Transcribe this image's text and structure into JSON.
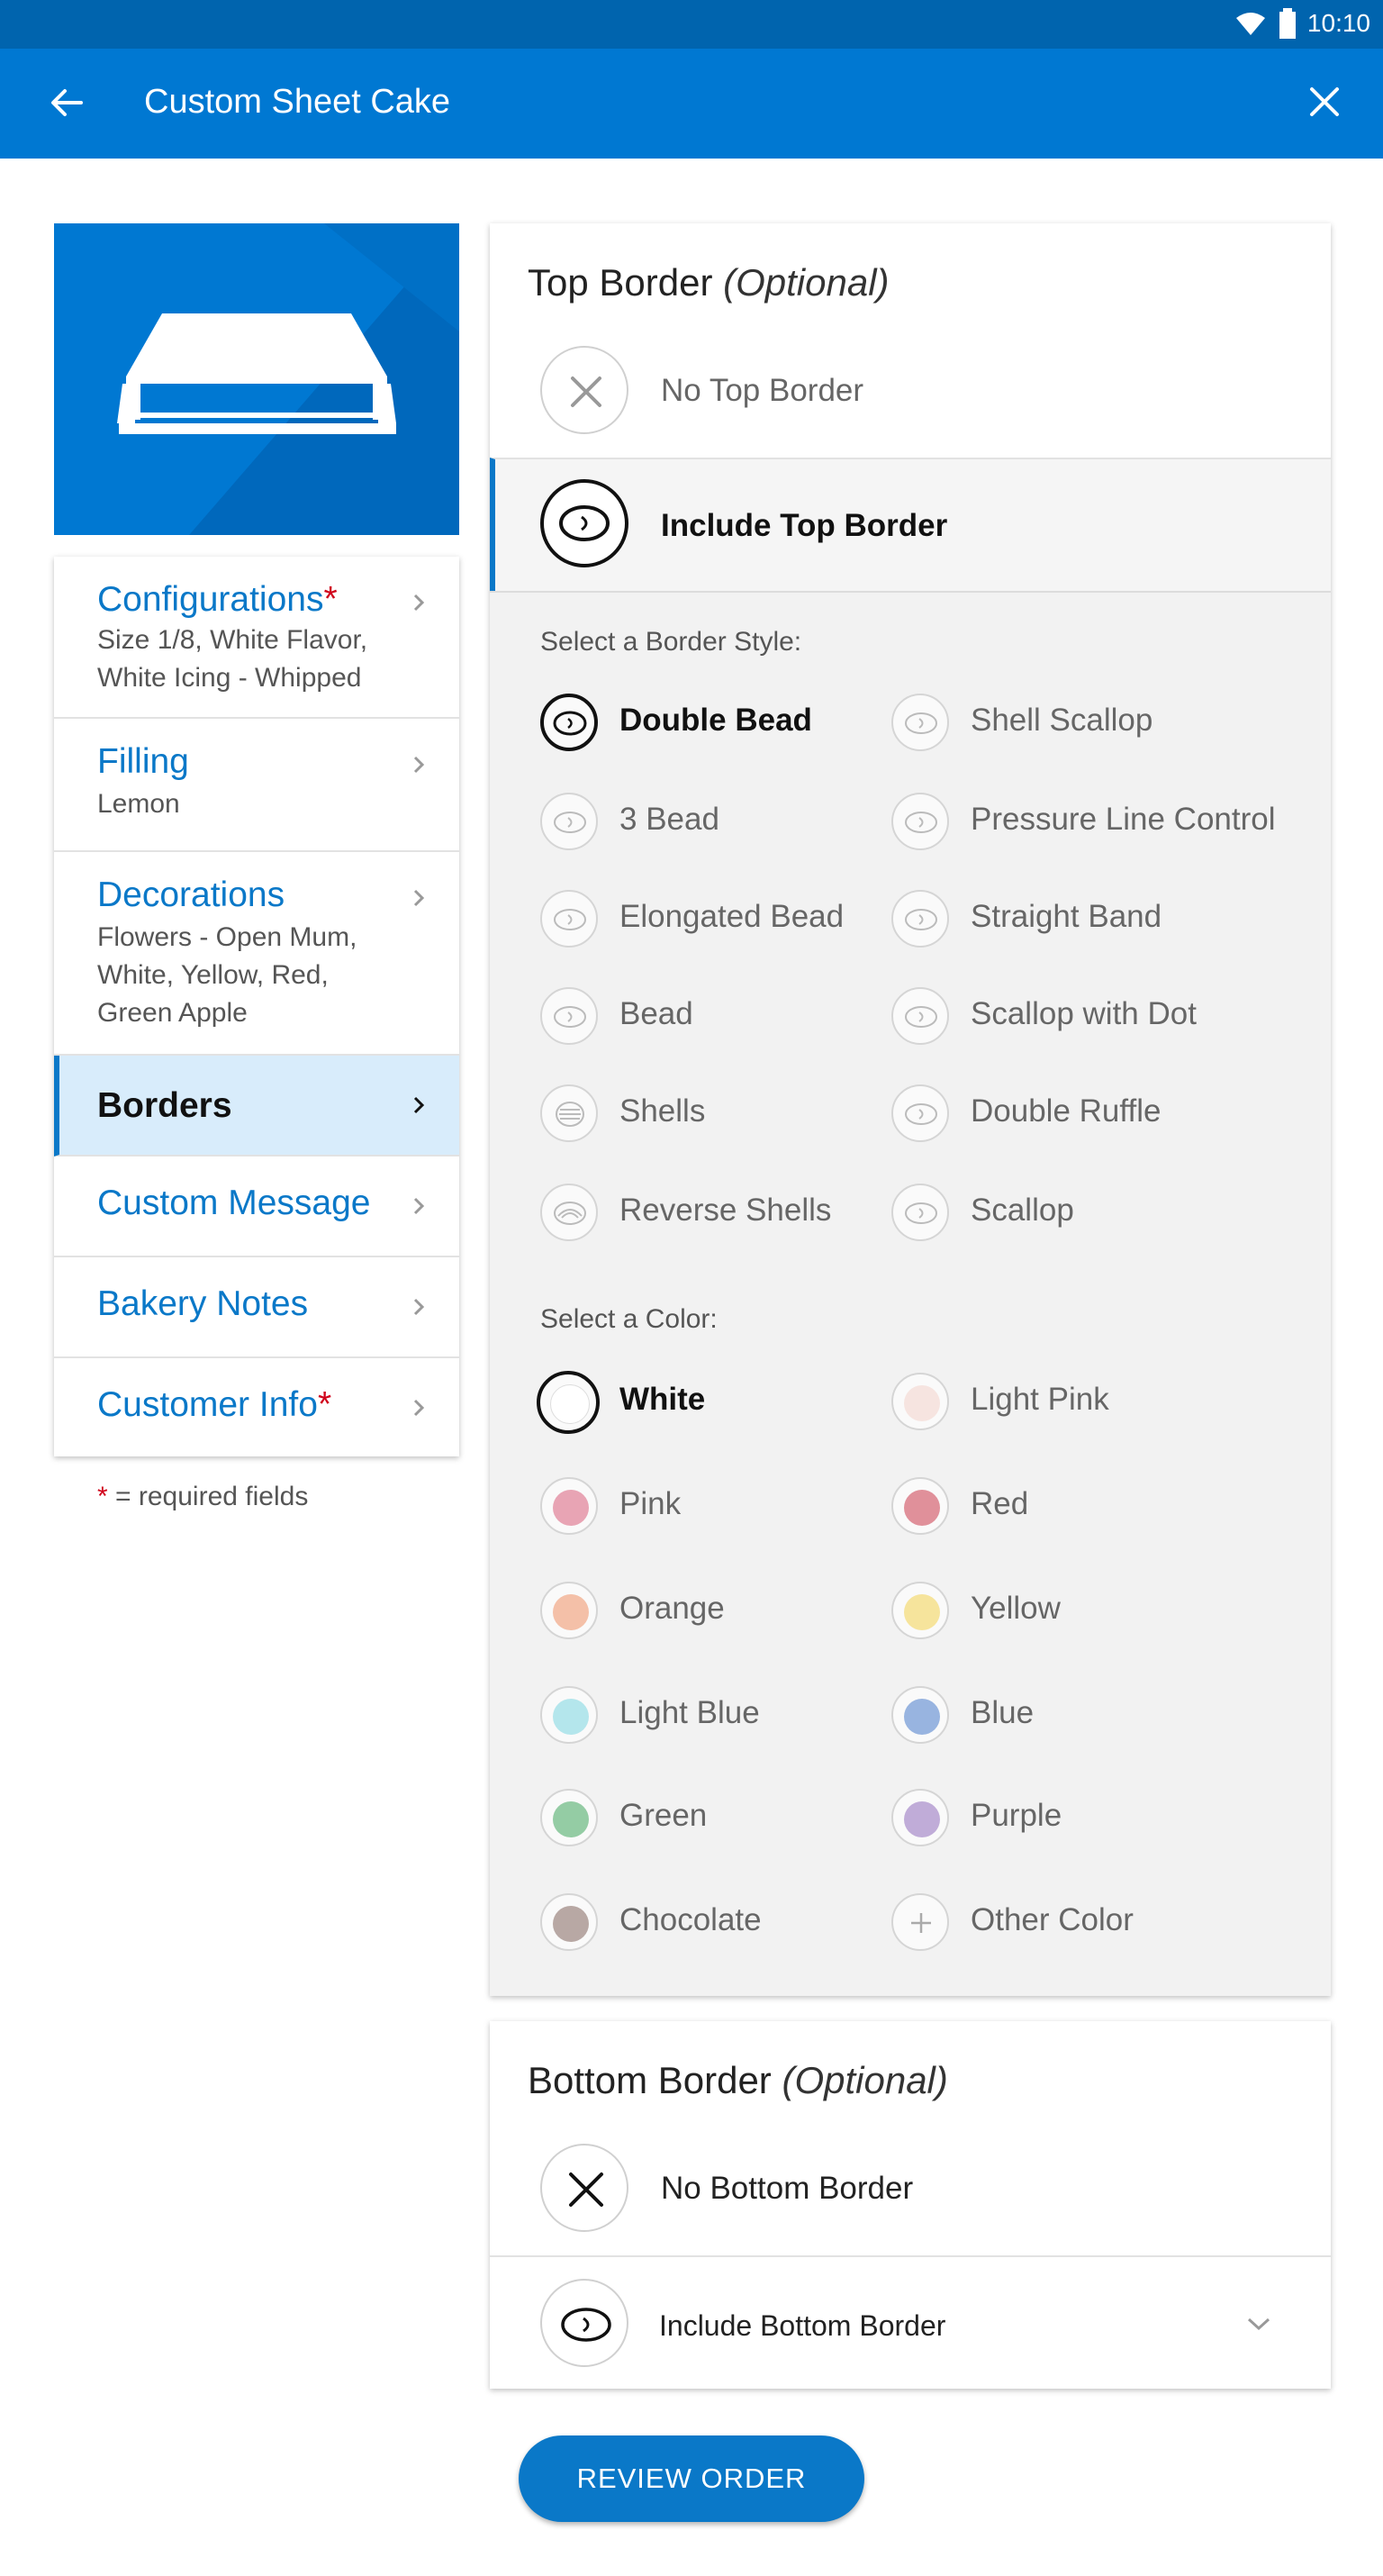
{
  "status_bar": {
    "time": "10:10"
  },
  "app_bar": {
    "title": "Custom Sheet Cake"
  },
  "nav": {
    "items": [
      {
        "label": "Configurations",
        "required": "*",
        "sub": [
          "Size 1/8, White Flavor,",
          "White Icing - Whipped"
        ]
      },
      {
        "label": "Filling",
        "required": "",
        "sub": [
          "Lemon"
        ]
      },
      {
        "label": "Decorations",
        "required": "",
        "sub": [
          "Flowers - Open Mum,",
          "White, Yellow, Red,",
          "Green Apple"
        ]
      },
      {
        "label": "Borders",
        "required": "",
        "sub": []
      },
      {
        "label": "Custom Message",
        "required": "",
        "sub": []
      },
      {
        "label": "Bakery Notes",
        "required": "",
        "sub": []
      },
      {
        "label": "Customer Info",
        "required": "*",
        "sub": []
      }
    ],
    "required_note_star": "*",
    "required_note": "= required fields"
  },
  "top_border": {
    "title": "Top Border",
    "optional": "(Optional)",
    "no_option": "No Top Border",
    "include_option": "Include Top Border",
    "style_label": "Select a Border Style:",
    "styles": [
      "Double Bead",
      "Shell Scallop",
      "3 Bead",
      "Pressure Line Control",
      "Elongated Bead",
      "Straight Band",
      "Bead",
      "Scallop with Dot",
      "Shells",
      "Double Ruffle",
      "Reverse Shells",
      "Scallop"
    ],
    "selected_style": "Double Bead",
    "color_label": "Select a Color:",
    "colors": [
      {
        "name": "White",
        "hex": "#ffffff"
      },
      {
        "name": "Light Pink",
        "hex": "#f6e4e0"
      },
      {
        "name": "Pink",
        "hex": "#e8a4b4"
      },
      {
        "name": "Red",
        "hex": "#e0909a"
      },
      {
        "name": "Orange",
        "hex": "#f4c0a8"
      },
      {
        "name": "Yellow",
        "hex": "#f6e49c"
      },
      {
        "name": "Light Blue",
        "hex": "#b4e6ec"
      },
      {
        "name": "Blue",
        "hex": "#98b4e0"
      },
      {
        "name": "Green",
        "hex": "#94cca4"
      },
      {
        "name": "Purple",
        "hex": "#c0acd8"
      },
      {
        "name": "Chocolate",
        "hex": "#b8a8a4"
      },
      {
        "name": "Other Color",
        "hex": ""
      }
    ],
    "selected_color": "White"
  },
  "bottom_border": {
    "title": "Bottom Border",
    "optional": "(Optional)",
    "no_option": "No Bottom Border",
    "include_option": "Include Bottom Border"
  },
  "review_button": "REVIEW ORDER",
  "colors": {
    "primary": "#0078d2",
    "status_bar": "#0064ae",
    "accent_text": "#0a78c8",
    "required": "#d0021b"
  }
}
